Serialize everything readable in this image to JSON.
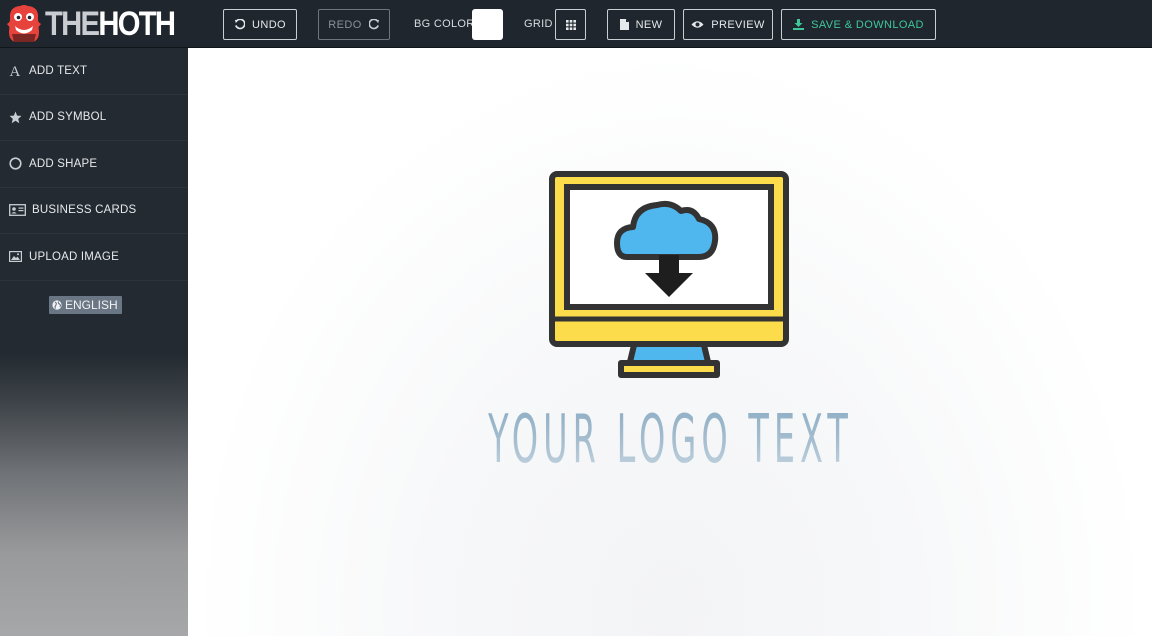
{
  "brand": {
    "prefix": "THE",
    "suffix": "HOTH"
  },
  "toolbar": {
    "undo_label": "UNDO",
    "redo_label": "REDO",
    "bg_color_label": "BG COLOR",
    "bg_color_value": "#ffffff",
    "grid_label": "GRID",
    "new_label": "NEW",
    "preview_label": "PREVIEW",
    "save_label": "SAVE & DOWNLOAD"
  },
  "sidebar": {
    "items": [
      {
        "label": "ADD TEXT",
        "icon": "text-icon"
      },
      {
        "label": "ADD SYMBOL",
        "icon": "star-icon"
      },
      {
        "label": "ADD SHAPE",
        "icon": "circle-icon"
      },
      {
        "label": "BUSINESS CARDS",
        "icon": "id-card-icon"
      },
      {
        "label": "UPLOAD IMAGE",
        "icon": "image-icon"
      }
    ],
    "language_label": "ENGLISH"
  },
  "canvas": {
    "logo_text": "YOUR LOGO TEXT",
    "logo_symbol": "monitor-cloud-download-icon"
  },
  "colors": {
    "topbar_bg": "#1f262d",
    "sidebar_bg": "#232a31",
    "accent_save": "#3fc79a",
    "monitor_yellow": "#fcdc4a",
    "cloud_blue": "#4fb6ee",
    "logo_text": "#93b1c7"
  }
}
